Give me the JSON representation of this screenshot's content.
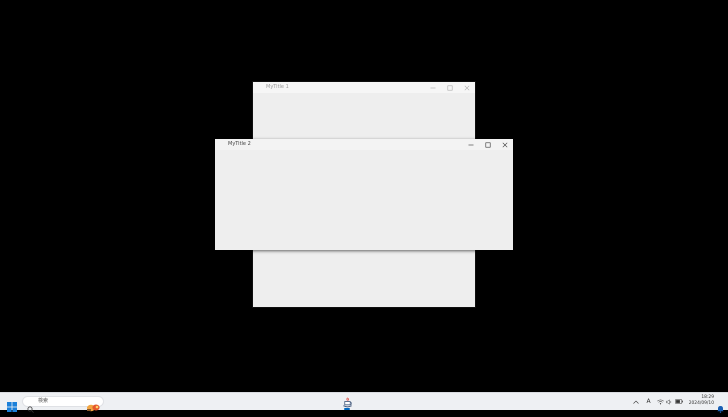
{
  "windows": [
    {
      "id": "win1",
      "title": "MyTitle 1"
    },
    {
      "id": "win2",
      "title": "MyTitle 2"
    }
  ],
  "caption_buttons": {
    "minimize": "minimize-icon",
    "maximize": "maximize-icon",
    "close": "close-icon"
  },
  "taskbar": {
    "search": {
      "placeholder": "検索"
    },
    "ime": "A",
    "clock": {
      "time": "18:29",
      "date": "2024/09/10"
    }
  },
  "colors": {
    "desktop": "#000000",
    "window_bg": "#eeeeee",
    "taskbar_bg": "#eef0f3",
    "accent": "#0067c0"
  },
  "icons": [
    "java-app-icon",
    "windows-start-icon",
    "search-icon",
    "wifi-icon",
    "volume-icon",
    "battery-icon",
    "notification-bell-icon",
    "chevron-up-icon"
  ]
}
